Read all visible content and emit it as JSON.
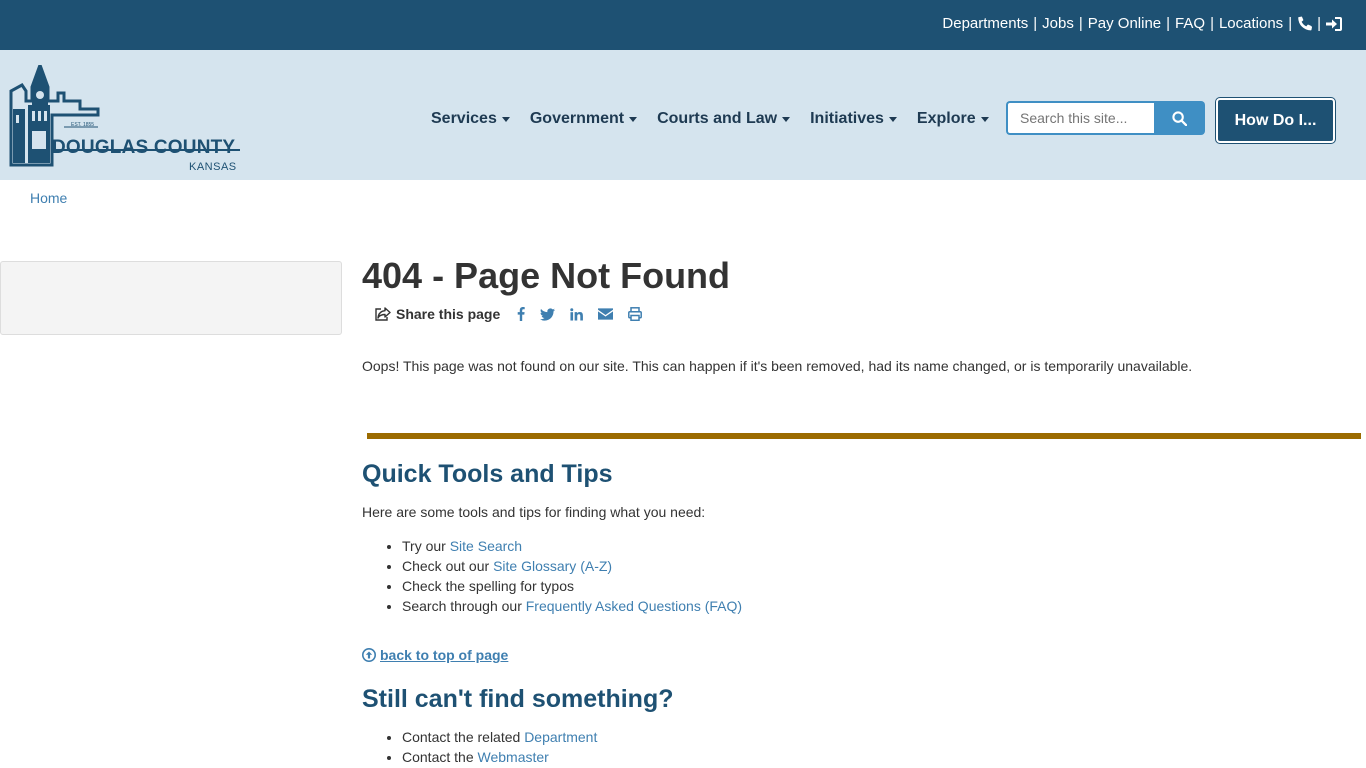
{
  "topbar": {
    "links": [
      "Departments",
      "Jobs",
      "Pay Online",
      "FAQ",
      "Locations"
    ],
    "separator": "|",
    "icons": [
      "phone-icon",
      "sign-in-icon"
    ]
  },
  "logo": {
    "name": "DOUGLAS COUNTY",
    "sub": "KANSAS",
    "est": "EST. 1855"
  },
  "nav": {
    "items": [
      "Services",
      "Government",
      "Courts and Law",
      "Initiatives",
      "Explore"
    ]
  },
  "search": {
    "placeholder": "Search this site..."
  },
  "howdo": {
    "label": "How Do I..."
  },
  "breadcrumb": {
    "home": "Home"
  },
  "main": {
    "title": "404 - Page Not Found",
    "share_label": "Share this page",
    "intro": "Oops! This page was not found on our site. This can happen if it's been removed, had its name changed, or is temporarily unavailable.",
    "quick_title": "Quick Tools and Tips",
    "quick_intro": "Here are some tools and tips for finding what you need:",
    "tips": [
      {
        "prefix": "Try our ",
        "link": "Site Search"
      },
      {
        "prefix": "Check out our ",
        "link": "Site Glossary (A-Z)"
      },
      {
        "prefix": "Check the spelling for typos",
        "link": ""
      },
      {
        "prefix": "Search through our ",
        "link": "Frequently Asked Questions (FAQ)"
      }
    ],
    "back_to_top": "back to top of page",
    "still_title": "Still can't find something?",
    "contact": [
      {
        "prefix": "Contact the related ",
        "link": "Department"
      },
      {
        "prefix": "Contact the ",
        "link": "Webmaster"
      }
    ]
  },
  "colors": {
    "topbar": "#1e5173",
    "header": "#d5e4ee",
    "accent_rule": "#9b6b00",
    "link": "#3f7fb0"
  }
}
